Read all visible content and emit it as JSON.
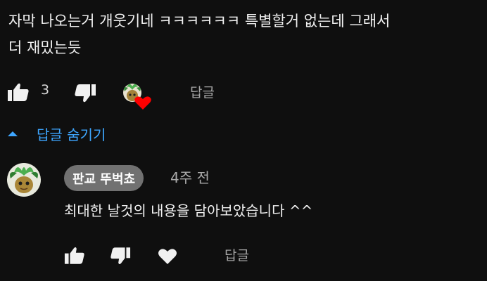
{
  "comment": {
    "text_line1": "자막 나오는거 개웃기네 ㅋㅋㅋㅋㅋㅋ 특별할거 없는데 그래서",
    "text_line2": "더 재밌는듯",
    "like_count": "3",
    "reply_label": "답글",
    "heart_by_creator": true
  },
  "replies_toggle": {
    "label": "답글 숨기기"
  },
  "reply": {
    "author": "판교 뚜벅쵸",
    "time": "4주 전",
    "text": "최대한 날것의 내용을 담아보았습니다 ^^",
    "reply_label": "답글"
  },
  "colors": {
    "background": "#0f0f0f",
    "text": "#f1f1f1",
    "secondary_text": "#aaaaaa",
    "link": "#3ea6ff",
    "heart": "#ff0000",
    "author_badge": "#717171"
  },
  "icons": {
    "like": "thumbs-up-icon",
    "dislike": "thumbs-down-icon",
    "heart": "heart-icon",
    "hide": "chevron-up-icon"
  }
}
